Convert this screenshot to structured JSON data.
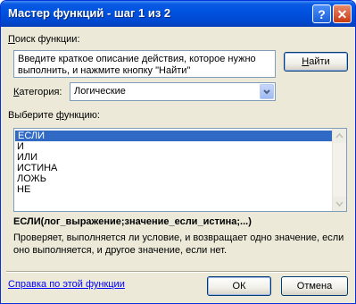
{
  "window": {
    "title": "Мастер функций - шаг 1 из 2",
    "help_glyph": "?",
    "close_glyph": "✕"
  },
  "search": {
    "label_underlined": "П",
    "label_rest": "оиск функции:",
    "text": "Введите краткое описание действия, которое нужно выполнить, и нажмите кнопку \"Найти\"",
    "find_underlined": "Н",
    "find_rest": "айти"
  },
  "category": {
    "label_underlined": "К",
    "label_rest": "атегория:",
    "value": "Логические"
  },
  "functions": {
    "label_prefix": "Выберите ",
    "label_underlined": "ф",
    "label_rest": "ункцию:",
    "items": [
      "ЕСЛИ",
      "И",
      "ИЛИ",
      "ИСТИНА",
      "ЛОЖЬ",
      "НЕ"
    ],
    "selected_index": 0
  },
  "signature": "ЕСЛИ(лог_выражение;значение_если_истина;...)",
  "description": "Проверяет, выполняется ли условие, и возвращает одно значение, если оно выполняется, и другое значение, если нет.",
  "help_link": "Справка по этой функции",
  "ok_label": "ОК",
  "cancel_label": "Отмена",
  "colors": {
    "title_bar": "#0054e3",
    "dialog_bg": "#ece9d8",
    "selection": "#316ac5",
    "link": "#0000ff"
  }
}
